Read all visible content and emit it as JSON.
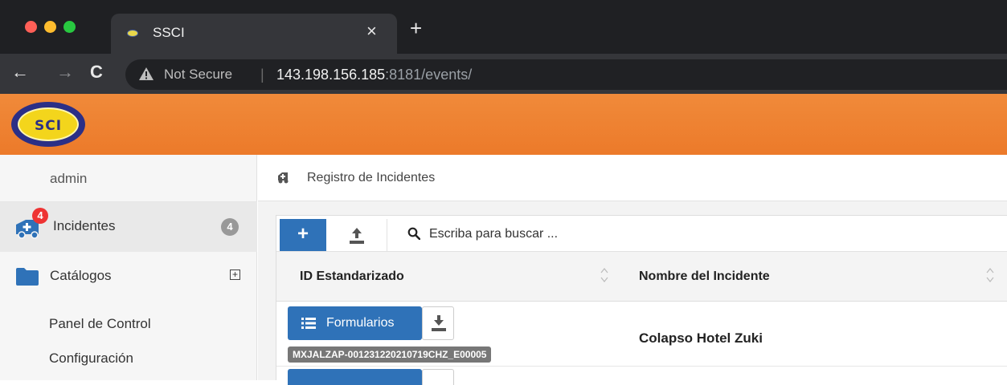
{
  "browser": {
    "tab_title": "SSCI",
    "tab_close": "×",
    "new_tab": "+",
    "nav_back": "←",
    "nav_forward": "→",
    "nav_reload": "C",
    "security_label": "Not Secure",
    "separator": "|",
    "url_host": "143.198.156.185",
    "url_rest": ":8181/events/"
  },
  "app": {
    "logo_text": "SCI",
    "brand_color": "#ee7f30"
  },
  "sidebar": {
    "user": "admin",
    "items": [
      {
        "label": "Incidentes",
        "badge": "4",
        "icon": "ambulance-icon",
        "icon_badge": "4"
      },
      {
        "label": "Catálogos",
        "icon": "folder-icon",
        "expand": "+"
      }
    ],
    "subitems": [
      "Panel de Control",
      "Configuración"
    ]
  },
  "main": {
    "page_title": "Registro de Incidentes",
    "toolbar": {
      "add_label": "+",
      "search_placeholder": "Escriba para buscar ..."
    },
    "table": {
      "columns": [
        "ID Estandarizado",
        "Nombre del Incidente"
      ],
      "rows": [
        {
          "forms_label": "Formularios",
          "standard_id": "MXJALZAP-001231220210719CHZ_E00005",
          "name": "Colapso Hotel Zuki"
        }
      ]
    }
  }
}
